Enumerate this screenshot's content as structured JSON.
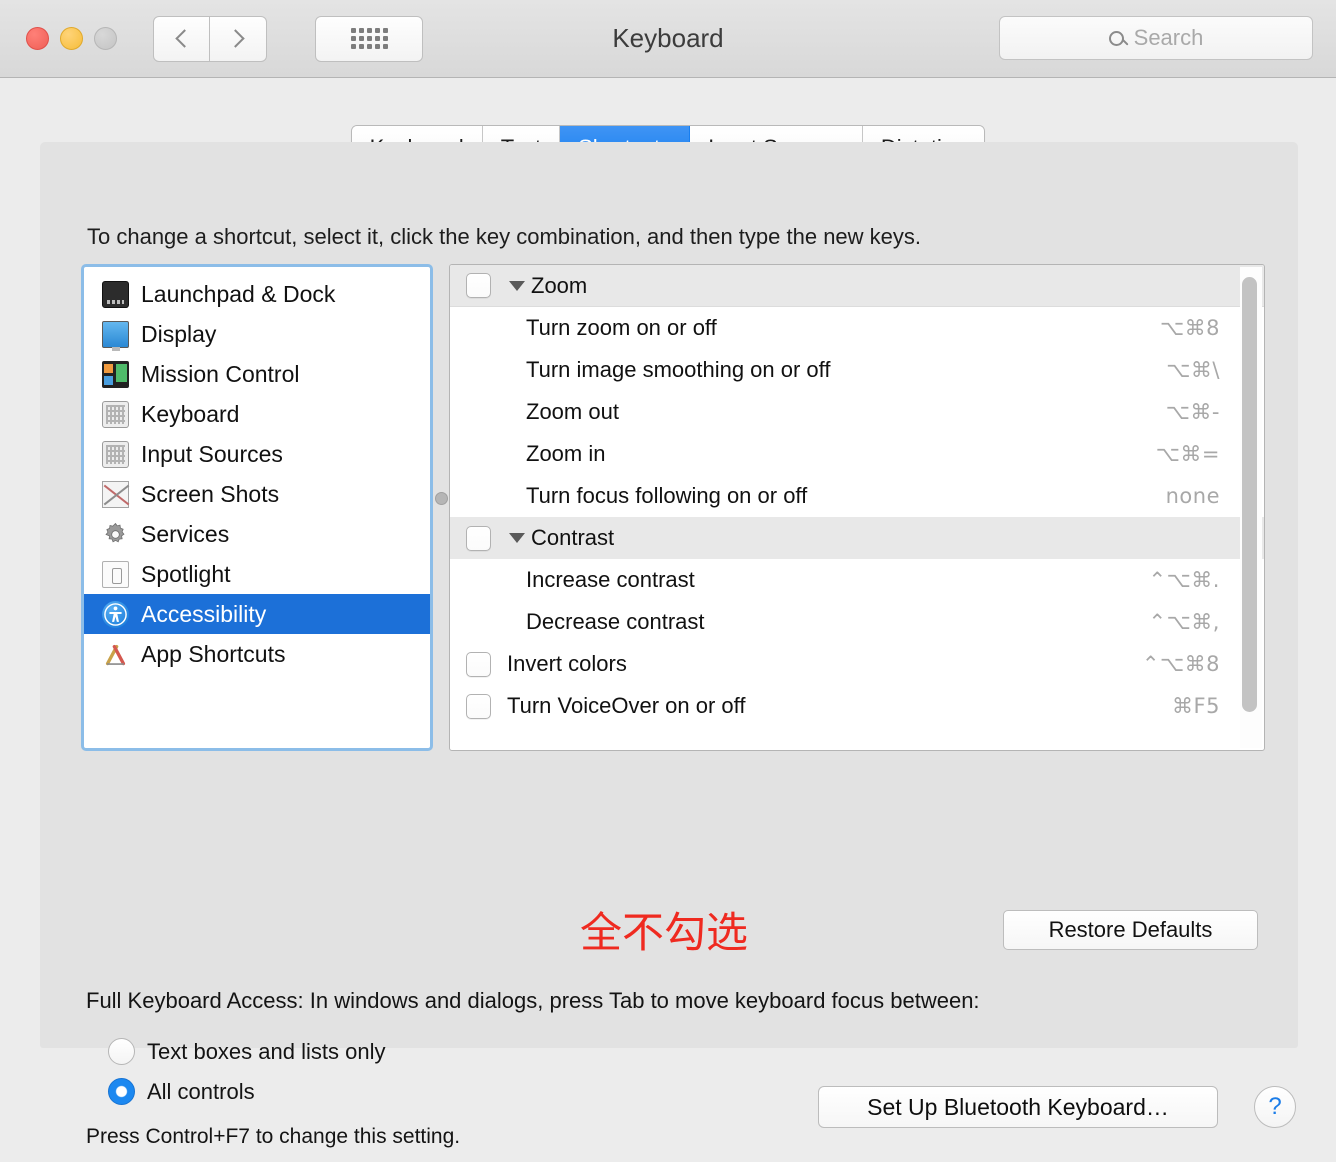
{
  "window": {
    "title": "Keyboard",
    "traffic_lights": [
      "close",
      "minimize",
      "zoom"
    ],
    "nav_back": "back-arrow",
    "nav_forward": "forward-arrow",
    "grid_button": "show-all-icon",
    "search": {
      "placeholder": "Search",
      "value": "",
      "icon": "search-icon"
    }
  },
  "tabs": [
    {
      "label": "Keyboard",
      "active": false
    },
    {
      "label": "Text",
      "active": false
    },
    {
      "label": "Shortcuts",
      "active": true
    },
    {
      "label": "Input Sources",
      "active": false
    },
    {
      "label": "Dictation",
      "active": false
    }
  ],
  "hint": "To change a shortcut, select it, click the key combination, and then type the new keys.",
  "sidebar": {
    "items": [
      {
        "label": "Launchpad & Dock",
        "icon": "launchpad-dock-icon",
        "selected": false
      },
      {
        "label": "Display",
        "icon": "display-icon",
        "selected": false
      },
      {
        "label": "Mission Control",
        "icon": "mission-control-icon",
        "selected": false
      },
      {
        "label": "Keyboard",
        "icon": "keyboard-icon",
        "selected": false
      },
      {
        "label": "Input Sources",
        "icon": "input-sources-icon",
        "selected": false
      },
      {
        "label": "Screen Shots",
        "icon": "screen-shots-icon",
        "selected": false
      },
      {
        "label": "Services",
        "icon": "gear-icon",
        "selected": false
      },
      {
        "label": "Spotlight",
        "icon": "spotlight-icon",
        "selected": false
      },
      {
        "label": "Accessibility",
        "icon": "accessibility-icon",
        "selected": true
      },
      {
        "label": "App Shortcuts",
        "icon": "app-shortcuts-icon",
        "selected": false
      }
    ]
  },
  "shortcut_list": {
    "rows": [
      {
        "label": "Zoom",
        "keys": "",
        "type": "group",
        "checked": false
      },
      {
        "label": "Turn zoom on or off",
        "keys": "⌥⌘8",
        "type": "child"
      },
      {
        "label": "Turn image smoothing on or off",
        "keys": "⌥⌘\\",
        "type": "child"
      },
      {
        "label": "Zoom out",
        "keys": "⌥⌘-",
        "type": "child"
      },
      {
        "label": "Zoom in",
        "keys": "⌥⌘=",
        "type": "child"
      },
      {
        "label": "Turn focus following on or off",
        "keys": "none",
        "type": "child"
      },
      {
        "label": "Contrast",
        "keys": "",
        "type": "group",
        "checked": false
      },
      {
        "label": "Increase contrast",
        "keys": "⌃⌥⌘.",
        "type": "child"
      },
      {
        "label": "Decrease contrast",
        "keys": "⌃⌥⌘,",
        "type": "child"
      },
      {
        "label": "Invert colors",
        "keys": "⌃⌥⌘8",
        "type": "top",
        "checked": false
      },
      {
        "label": "Turn VoiceOver on or off",
        "keys": "⌘F5",
        "type": "top",
        "checked": false
      }
    ],
    "scrollbar": "vertical-scrollbar"
  },
  "annotation": {
    "text": "全不勾选",
    "color": "#ef2a20"
  },
  "restore_button": {
    "label": "Restore Defaults"
  },
  "full_keyboard_access": {
    "description": "Full Keyboard Access: In windows and dialogs, press Tab to move keyboard focus between:",
    "options": [
      {
        "label": "Text boxes and lists only",
        "selected": false
      },
      {
        "label": "All controls",
        "selected": true
      }
    ],
    "note": "Press Control+F7 to change this setting."
  },
  "footer": {
    "bluetooth_button": "Set Up Bluetooth Keyboard…",
    "help_button": "?"
  },
  "colors": {
    "accent": "#1c70d8",
    "tab_active": "#177ef0",
    "annotation_red": "#ef2a20"
  }
}
